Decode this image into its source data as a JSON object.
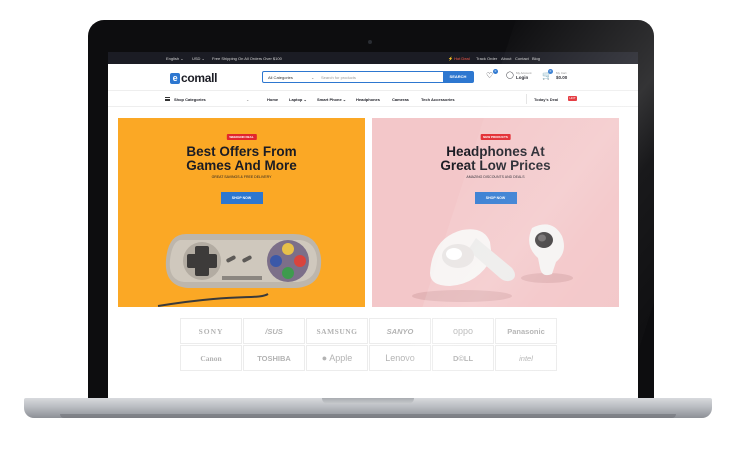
{
  "topbar": {
    "language": "English ⌄",
    "currency": "USD ⌄",
    "promo": "Free Shipping On All Orders Over $100",
    "hot_deals": "⚡ Hot Deal",
    "links": [
      "Track Order",
      "About",
      "Contact",
      "Blog"
    ]
  },
  "header": {
    "logo": "comall",
    "logo_mark": "e",
    "search": {
      "category": "All Categories",
      "placeholder": "Search for products",
      "button": "SEARCH"
    },
    "wishlist_count": "0",
    "account": {
      "small": "My Account",
      "label": "Login"
    },
    "cart": {
      "small": "My Cart",
      "total": "$0.00",
      "count": "0"
    }
  },
  "nav": {
    "shop_categories": "Shop Categories",
    "items": [
      "Home",
      "Laptop ⌄",
      "Smart Phone ⌄",
      "Headphones",
      "Cameras",
      "Tech Accessories"
    ],
    "todays_deal": "Today's Deal",
    "deal_badge": "HOT"
  },
  "banners": [
    {
      "tag": "WEEKEND DEAL",
      "title_line1": "Best Offers From",
      "title_line2": "Games And More",
      "subtitle": "GREAT SAVINGS & FREE DELIVERY",
      "button": "SHOP NOW",
      "background": "#fba825"
    },
    {
      "tag": "NEW PRODUCTS",
      "title_line1": "Headphones At",
      "title_line2": "Great Low Prices",
      "subtitle": "AMAZING DISCOUNTS AND DEALS",
      "button": "SHOP NOW",
      "background": "#f3c7c9"
    }
  ],
  "brands": [
    "SONY",
    "/SUS",
    "SAMSUNG",
    "SANYO",
    "oppo",
    "Panasonic",
    "Canon",
    "TOSHIBA",
    "Apple",
    "Lenovo",
    "D©LL",
    "intel"
  ],
  "colors": {
    "accent": "#2d77d0",
    "hot": "#e2262d",
    "dark": "#1b1c24"
  }
}
